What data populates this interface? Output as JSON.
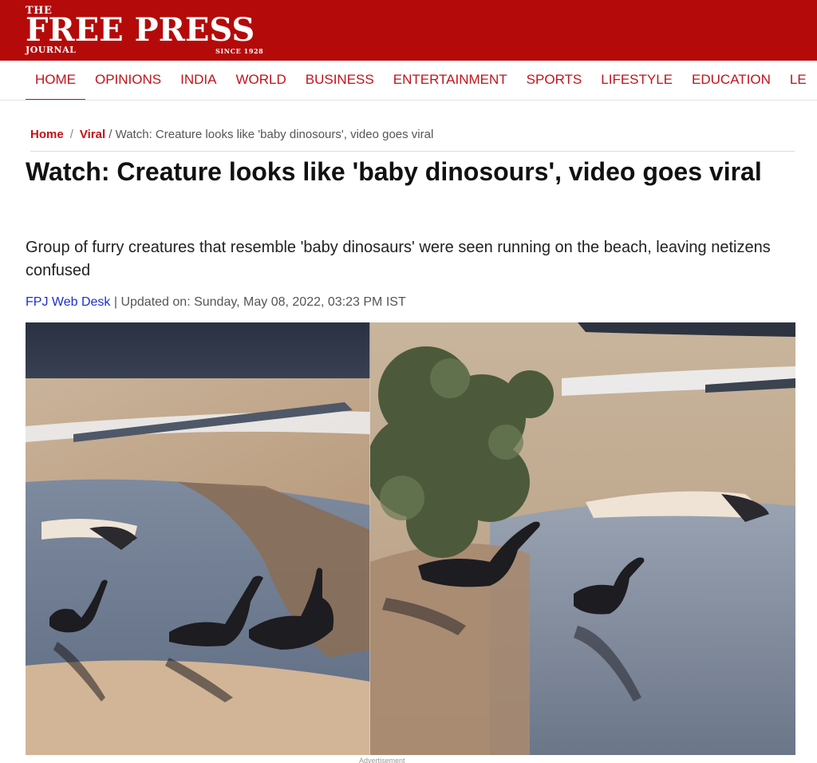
{
  "masthead": {
    "logo_the": "THE",
    "logo_main": "FREE PRESS",
    "logo_journal": "JOURNAL",
    "logo_since": "SINCE 1928",
    "background_color": "#b50a0a"
  },
  "nav": {
    "items": [
      {
        "label": "HOME",
        "active": true
      },
      {
        "label": "OPINIONS"
      },
      {
        "label": "INDIA"
      },
      {
        "label": "WORLD"
      },
      {
        "label": "BUSINESS"
      },
      {
        "label": "ENTERTAINMENT"
      },
      {
        "label": "SPORTS"
      },
      {
        "label": "LIFESTYLE"
      },
      {
        "label": "EDUCATION"
      },
      {
        "label": "LE"
      }
    ],
    "accent_color": "#c4121a"
  },
  "breadcrumb": {
    "home": "Home",
    "sep1": "/",
    "viral": "Viral",
    "current": "/ Watch: Creature looks like 'baby dinosours', video goes viral"
  },
  "article": {
    "headline": "Watch: Creature looks like 'baby dinosours', video goes viral",
    "subhead": "Group of furry creatures that resemble 'baby dinosaurs' were seen running on the beach, leaving netizens confused",
    "author": "FPJ Web Desk",
    "updated": " | Updated on: Sunday, May 08, 2022, 03:23 PM IST",
    "author_color": "#1a2fd1"
  },
  "hero": {
    "left_image": "beach-creatures-photo",
    "right_image": "beach-creatures-with-bush-photo"
  },
  "footer": {
    "ad_label": "Advertisement"
  }
}
